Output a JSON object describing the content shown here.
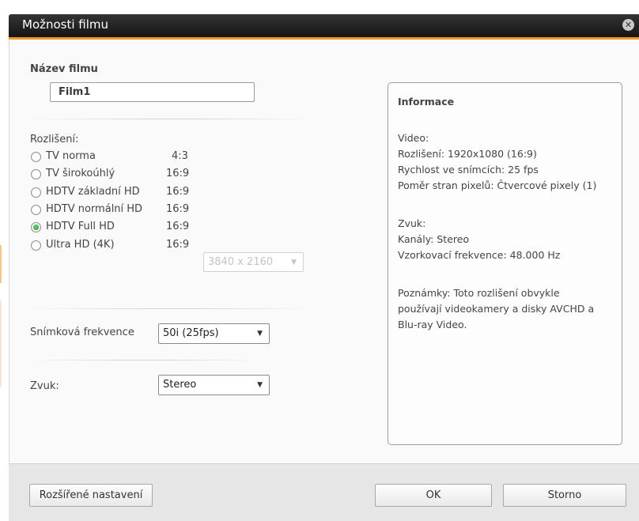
{
  "window": {
    "title": "Možnosti filmu"
  },
  "film_name": {
    "label": "Název filmu",
    "value": "Film1"
  },
  "resolution": {
    "label": "Rozlišení:",
    "options": [
      {
        "label": "TV norma",
        "ratio": "4:3",
        "checked": false
      },
      {
        "label": "TV širokoúhlý",
        "ratio": "16:9",
        "checked": false
      },
      {
        "label": "HDTV základní HD",
        "ratio": "16:9",
        "checked": false
      },
      {
        "label": "HDTV normální HD",
        "ratio": "16:9",
        "checked": false
      },
      {
        "label": "HDTV Full HD",
        "ratio": "16:9",
        "checked": true
      },
      {
        "label": "Ultra HD (4K)",
        "ratio": "16:9",
        "checked": false
      }
    ],
    "uhd_select": {
      "value": "3840 x 2160",
      "disabled": true
    }
  },
  "frame_rate": {
    "label": "Snímková frekvence",
    "value": "50i (25fps)"
  },
  "audio": {
    "label": "Zvuk:",
    "value": "Stereo"
  },
  "info": {
    "heading": "Informace",
    "video_lines": [
      "Video:",
      "Rozlišení: 1920x1080 (16:9)",
      "Rychlost ve snímcích: 25 fps",
      "Poměr stran pixelů: Čtvercové pixely (1)"
    ],
    "audio_lines": [
      "Zvuk:",
      "Kanály: Stereo",
      "Vzorkovací frekvence: 48.000 Hz"
    ],
    "notes_lines": [
      "Poznámky: Toto rozlišení obvykle",
      "používají videokamery a disky AVCHD a",
      "Blu-ray Video."
    ]
  },
  "buttons": {
    "advanced": "Rozšířené nastavení",
    "ok": "OK",
    "cancel": "Storno"
  },
  "colors": {
    "accent": "#f29a1d",
    "titlebar": "#1f1f1f",
    "radio_checked": "#2aa43a"
  },
  "icons": {
    "close": "close-circle-icon",
    "dropdown": "triangle-down-icon"
  }
}
